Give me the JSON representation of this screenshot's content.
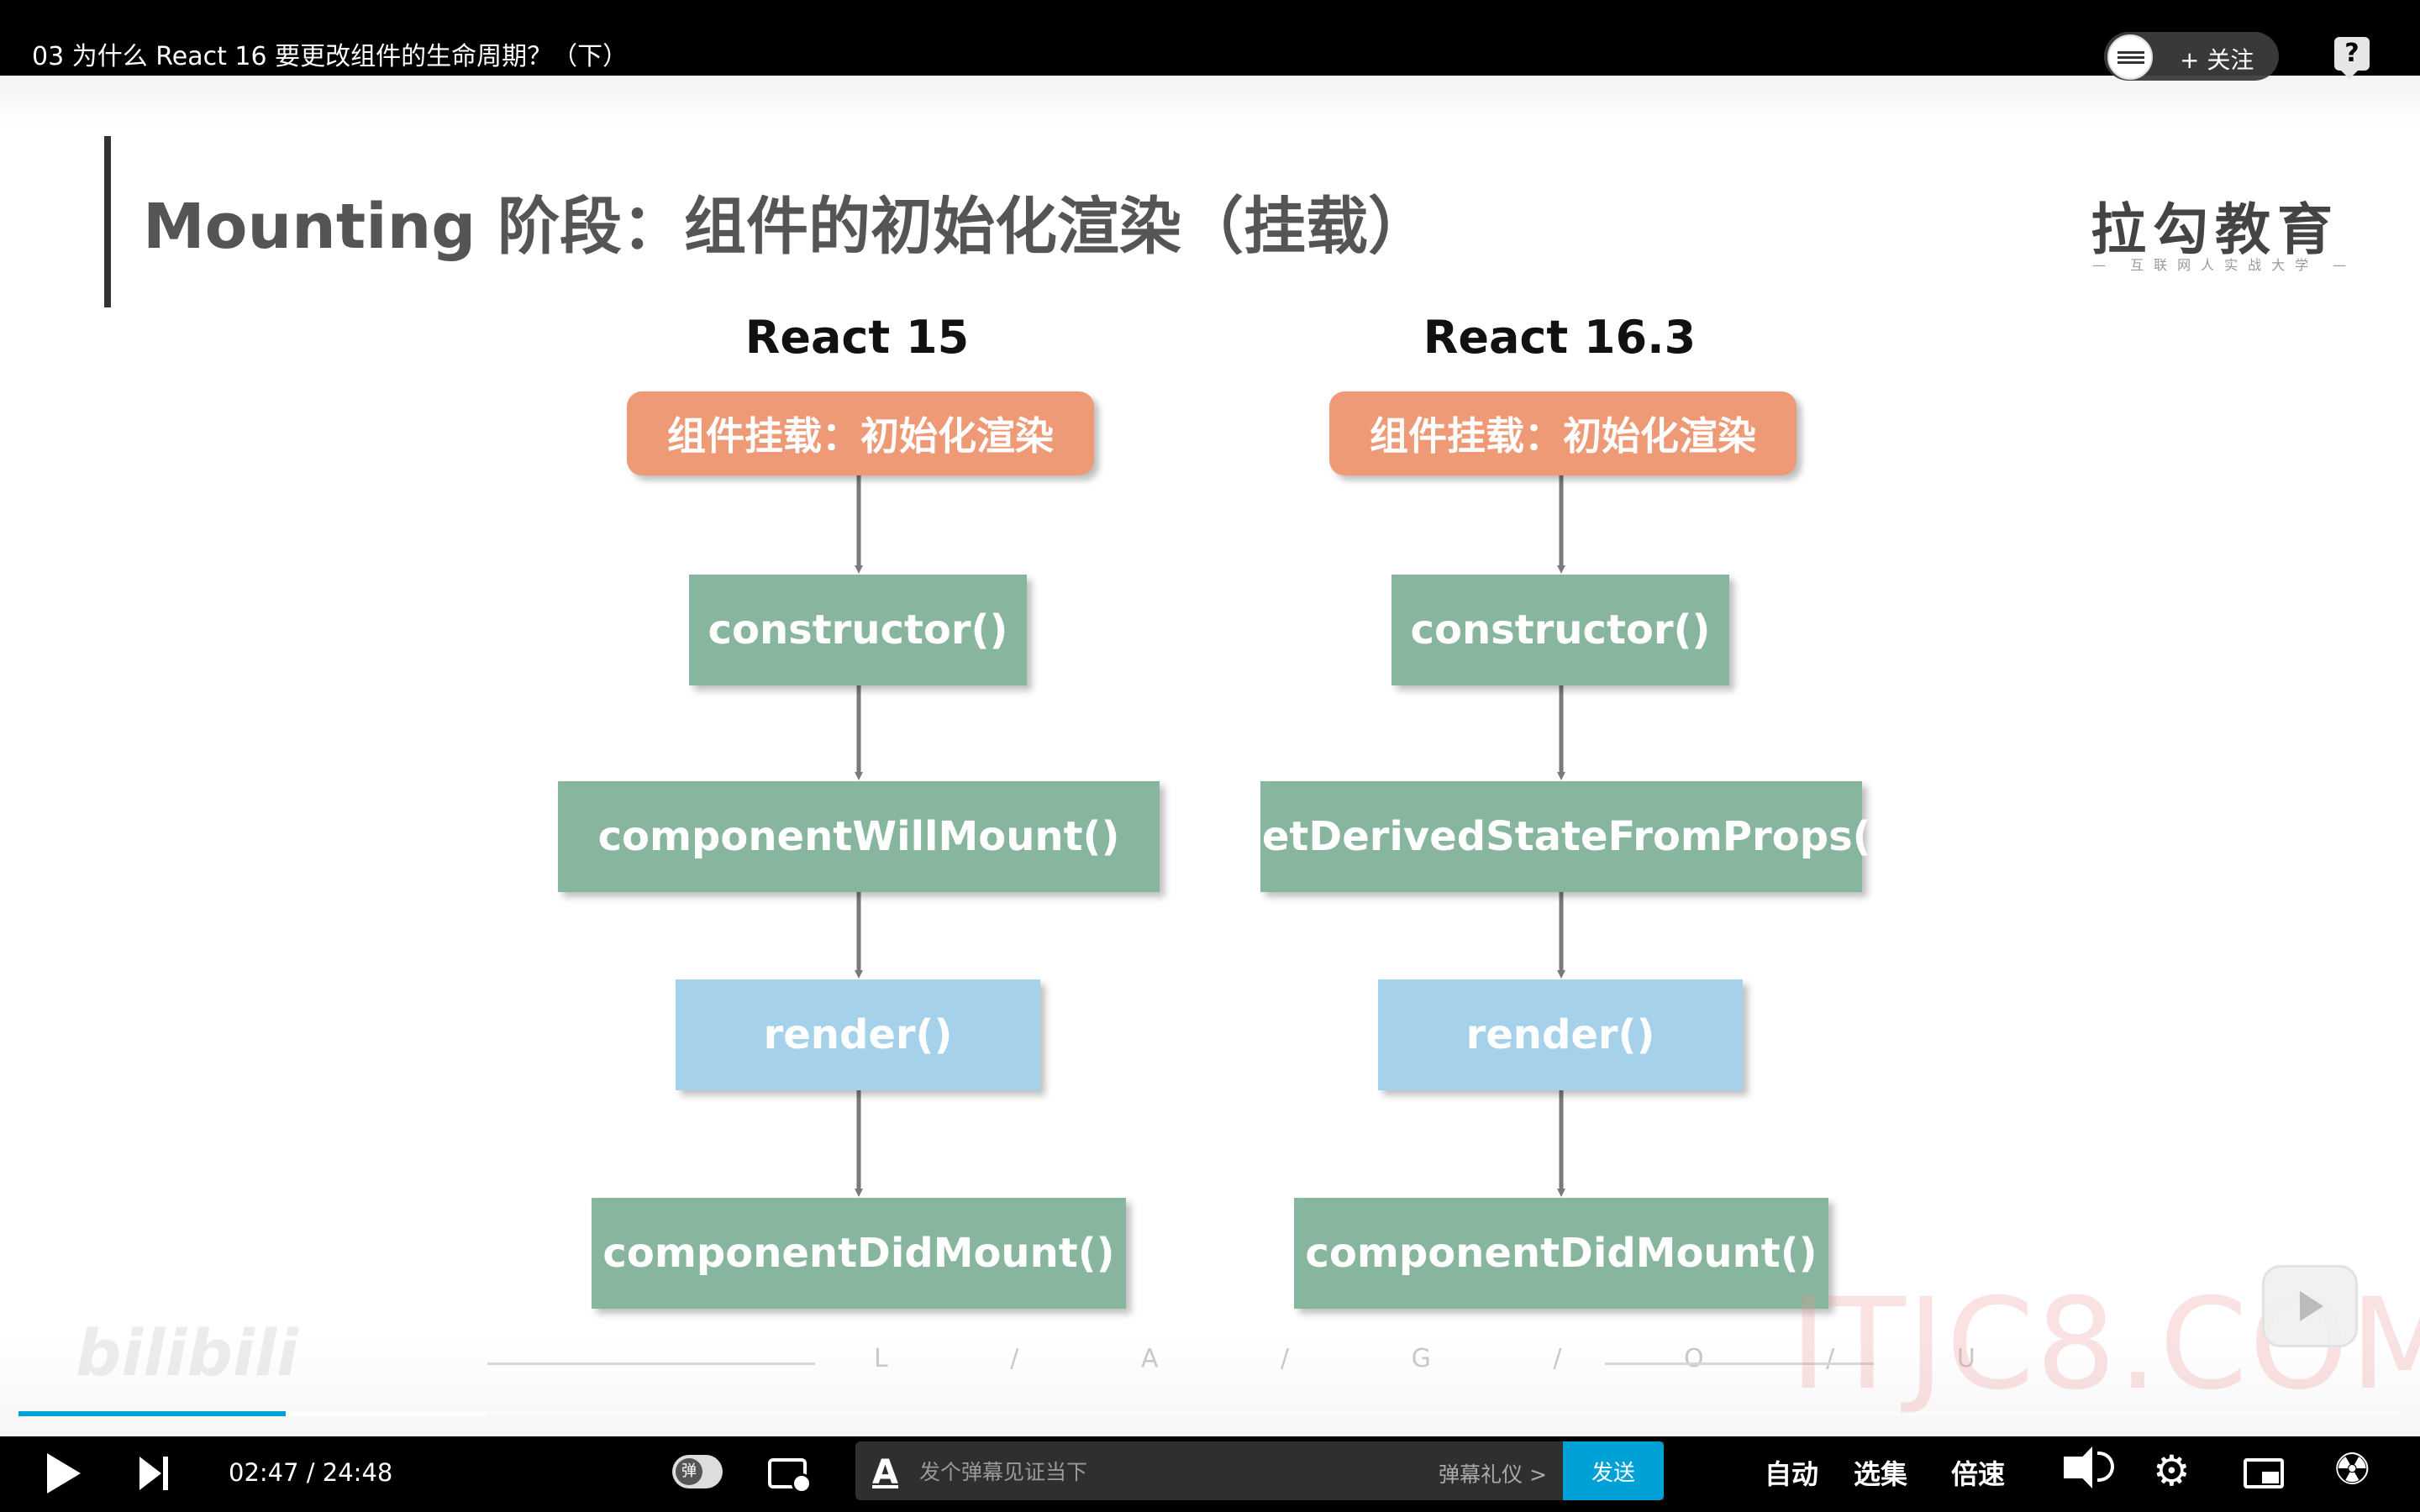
{
  "player": {
    "title": "03 为什么 React 16 要更改组件的生命周期？（下）",
    "follow_label": "+ 关注",
    "help_icon": "question-icon"
  },
  "slide": {
    "title": "Mounting 阶段：组件的初始化渲染（挂载）",
    "logo": "拉勾教育",
    "logo_tagline": "— 互联网人实战大学 —",
    "footer_letters": "L / A / G / O / U",
    "watermark_bilibili": "bilibili",
    "watermark_site": "ITJC8.COM",
    "colors": {
      "orange": "#ee9a77",
      "green": "#87b59d",
      "blue": "#a5d2ea",
      "arrow": "#7a7a7a"
    },
    "columns": [
      {
        "header": "React 15",
        "steps": [
          {
            "label": "组件挂载：初始化渲染",
            "kind": "orange"
          },
          {
            "label": "constructor()",
            "kind": "green"
          },
          {
            "label": "componentWillMount()",
            "kind": "green"
          },
          {
            "label": "render()",
            "kind": "blue"
          },
          {
            "label": "componentDidMount()",
            "kind": "green"
          }
        ]
      },
      {
        "header": "React 16.3",
        "steps": [
          {
            "label": "组件挂载：初始化渲染",
            "kind": "orange"
          },
          {
            "label": "constructor()",
            "kind": "green"
          },
          {
            "label": "getDerivedStateFromProps()",
            "kind": "green"
          },
          {
            "label": "render()",
            "kind": "blue"
          },
          {
            "label": "componentDidMount()",
            "kind": "green"
          }
        ]
      }
    ]
  },
  "controls": {
    "time_current": "02:47",
    "time_total": "24:48",
    "time_display": "02:47 / 24:48",
    "progress_fraction": 0.112,
    "buffer_fraction": 0.085,
    "danmaku_toggle_label": "弹",
    "danmaku_placeholder": "发个弹幕见证当下",
    "danmaku_etiquette": "弹幕礼仪 >",
    "send_label": "发送",
    "auto_label": "自动",
    "episodes_label": "选集",
    "speed_label": "倍速"
  }
}
